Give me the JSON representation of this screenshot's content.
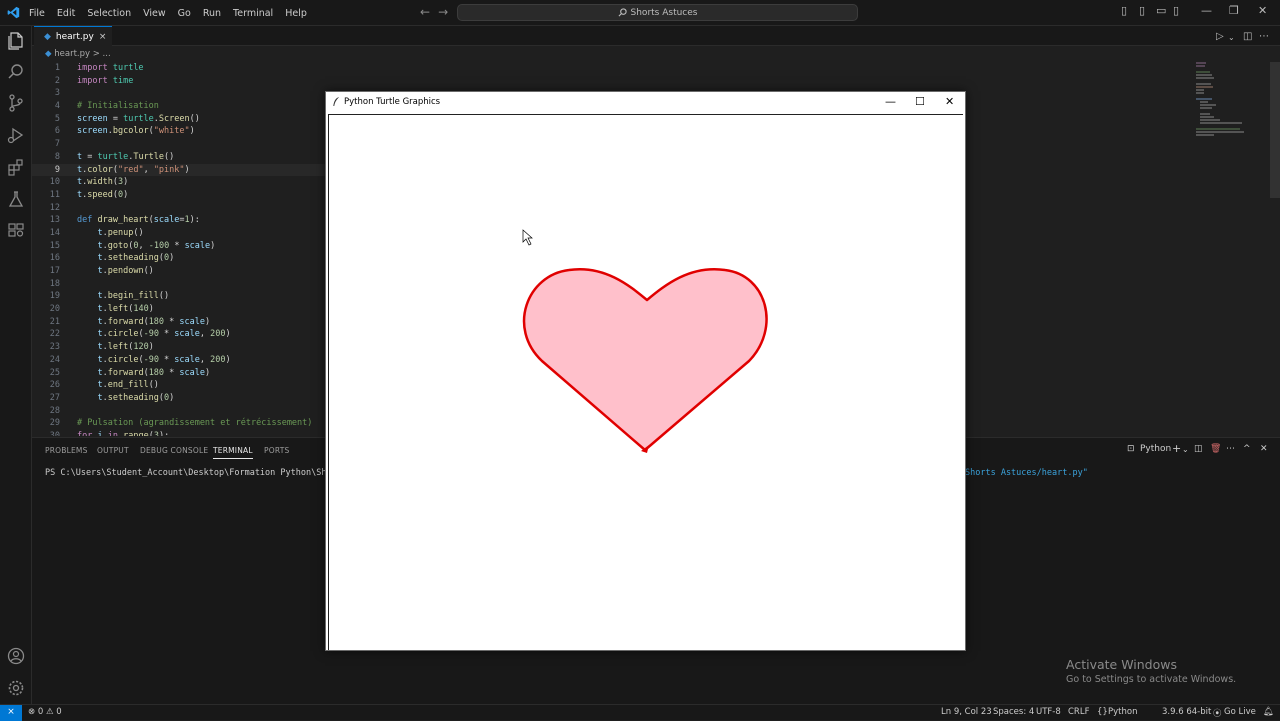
{
  "titlebar": {
    "menu": [
      "File",
      "Edit",
      "Selection",
      "View",
      "Go",
      "Run",
      "Terminal",
      "Help"
    ],
    "search": "Shorts Astuces"
  },
  "tab": {
    "label": "heart.py",
    "close": "×"
  },
  "breadcrumb": "heart.py > ...",
  "code_lines": [
    {
      "n": "1",
      "html": "<span class='kw'>import</span> <span class='cl'>turtle</span>"
    },
    {
      "n": "2",
      "html": "<span class='kw'>import</span> <span class='cl'>time</span>"
    },
    {
      "n": "3",
      "html": ""
    },
    {
      "n": "4",
      "html": "<span class='cm'># Initialisation</span>"
    },
    {
      "n": "5",
      "html": "<span class='vr'>screen</span> = <span class='cl'>turtle</span>.<span class='fn'>Screen</span>()"
    },
    {
      "n": "6",
      "html": "<span class='vr'>screen</span>.<span class='fn'>bgcolor</span>(<span class='st'>\"white\"</span>)"
    },
    {
      "n": "7",
      "html": ""
    },
    {
      "n": "8",
      "html": "<span class='vr'>t</span> = <span class='cl'>turtle</span>.<span class='fn'>Turtle</span>()"
    },
    {
      "n": "9",
      "html": "<span class='vr'>t</span>.<span class='fn'>color</span>(<span class='st'>\"red\"</span>, <span class='st'>\"pink\"</span>)"
    },
    {
      "n": "10",
      "html": "<span class='vr'>t</span>.<span class='fn'>width</span>(<span class='nm'>3</span>)"
    },
    {
      "n": "11",
      "html": "<span class='vr'>t</span>.<span class='fn'>speed</span>(<span class='nm'>0</span>)"
    },
    {
      "n": "12",
      "html": ""
    },
    {
      "n": "13",
      "html": "<span class='kb'>def</span> <span class='fn'>draw_heart</span>(<span class='vr'>scale</span>=<span class='nm'>1</span>):"
    },
    {
      "n": "14",
      "html": "    <span class='vr'>t</span>.<span class='fn'>penup</span>()"
    },
    {
      "n": "15",
      "html": "    <span class='vr'>t</span>.<span class='fn'>goto</span>(<span class='nm'>0</span>, <span class='nm'>-100</span> * <span class='vr'>scale</span>)"
    },
    {
      "n": "16",
      "html": "    <span class='vr'>t</span>.<span class='fn'>setheading</span>(<span class='nm'>0</span>)"
    },
    {
      "n": "17",
      "html": "    <span class='vr'>t</span>.<span class='fn'>pendown</span>()"
    },
    {
      "n": "18",
      "html": ""
    },
    {
      "n": "19",
      "html": "    <span class='vr'>t</span>.<span class='fn'>begin_fill</span>()"
    },
    {
      "n": "20",
      "html": "    <span class='vr'>t</span>.<span class='fn'>left</span>(<span class='nm'>140</span>)"
    },
    {
      "n": "21",
      "html": "    <span class='vr'>t</span>.<span class='fn'>forward</span>(<span class='nm'>180</span> * <span class='vr'>scale</span>)"
    },
    {
      "n": "22",
      "html": "    <span class='vr'>t</span>.<span class='fn'>circle</span>(<span class='nm'>-90</span> * <span class='vr'>scale</span>, <span class='nm'>200</span>)"
    },
    {
      "n": "23",
      "html": "    <span class='vr'>t</span>.<span class='fn'>left</span>(<span class='nm'>120</span>)"
    },
    {
      "n": "24",
      "html": "    <span class='vr'>t</span>.<span class='fn'>circle</span>(<span class='nm'>-90</span> * <span class='vr'>scale</span>, <span class='nm'>200</span>)"
    },
    {
      "n": "25",
      "html": "    <span class='vr'>t</span>.<span class='fn'>forward</span>(<span class='nm'>180</span> * <span class='vr'>scale</span>)"
    },
    {
      "n": "26",
      "html": "    <span class='vr'>t</span>.<span class='fn'>end_fill</span>()"
    },
    {
      "n": "27",
      "html": "    <span class='vr'>t</span>.<span class='fn'>setheading</span>(<span class='nm'>0</span>)"
    },
    {
      "n": "28",
      "html": ""
    },
    {
      "n": "29",
      "html": "<span class='cm'># Pulsation (agrandissement et rétrécissement)</span>"
    },
    {
      "n": "30",
      "html": "<span class='kw'>for</span> <span class='vr'>i</span> <span class='kw'>in</span> <span class='fn'>range</span>(<span class='nm'>3</span>):"
    }
  ],
  "active_line": "9",
  "panel": {
    "tabs": [
      "PROBLEMS",
      "OUTPUT",
      "DEBUG CONSOLE",
      "TERMINAL",
      "PORTS"
    ],
    "active_tab": "TERMINAL",
    "terminal_profile": "Python",
    "terminal_prompt": "PS C:\\Users\\Student_Account\\Desktop\\Formation Python\\Shorts",
    "terminal_tail": "Shorts Astuces/heart.py\""
  },
  "turtle_window": {
    "title": "Python Turtle Graphics",
    "fill_color": "#ffc0cb",
    "pen_color": "#e00000"
  },
  "watermark": {
    "line1": "Activate Windows",
    "line2": "Go to Settings to activate Windows."
  },
  "status": {
    "errors": "0",
    "warnings": "0",
    "position": "Ln 9, Col 23",
    "spaces": "Spaces: 4",
    "encoding": "UTF-8",
    "eol": "CRLF",
    "language": "Python",
    "interpreter": "3.9.6 64-bit",
    "golive": "Go Live"
  }
}
